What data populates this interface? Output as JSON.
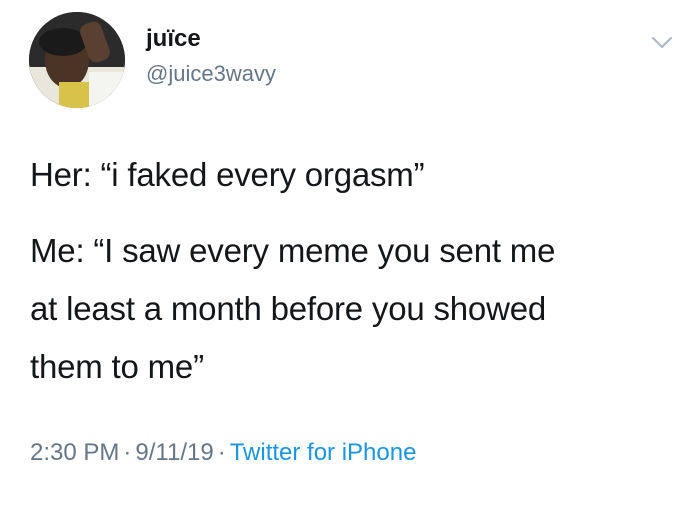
{
  "tweet": {
    "display_name": "juïce",
    "handle": "@juice3wavy",
    "lines": [
      "Her: “i faked every orgasm”",
      "Me: “I saw every meme you sent me",
      "at least a month before you showed",
      "them to me”"
    ],
    "time": "2:30 PM",
    "date": "9/11/19",
    "source": "Twitter for iPhone",
    "separator": "·"
  },
  "icons": {
    "avatar": "profile-photo",
    "menu": "chevron-down-icon"
  },
  "colors": {
    "text": "#14171a",
    "secondary": "#657786",
    "link": "#1b95e0",
    "background": "#ffffff"
  }
}
